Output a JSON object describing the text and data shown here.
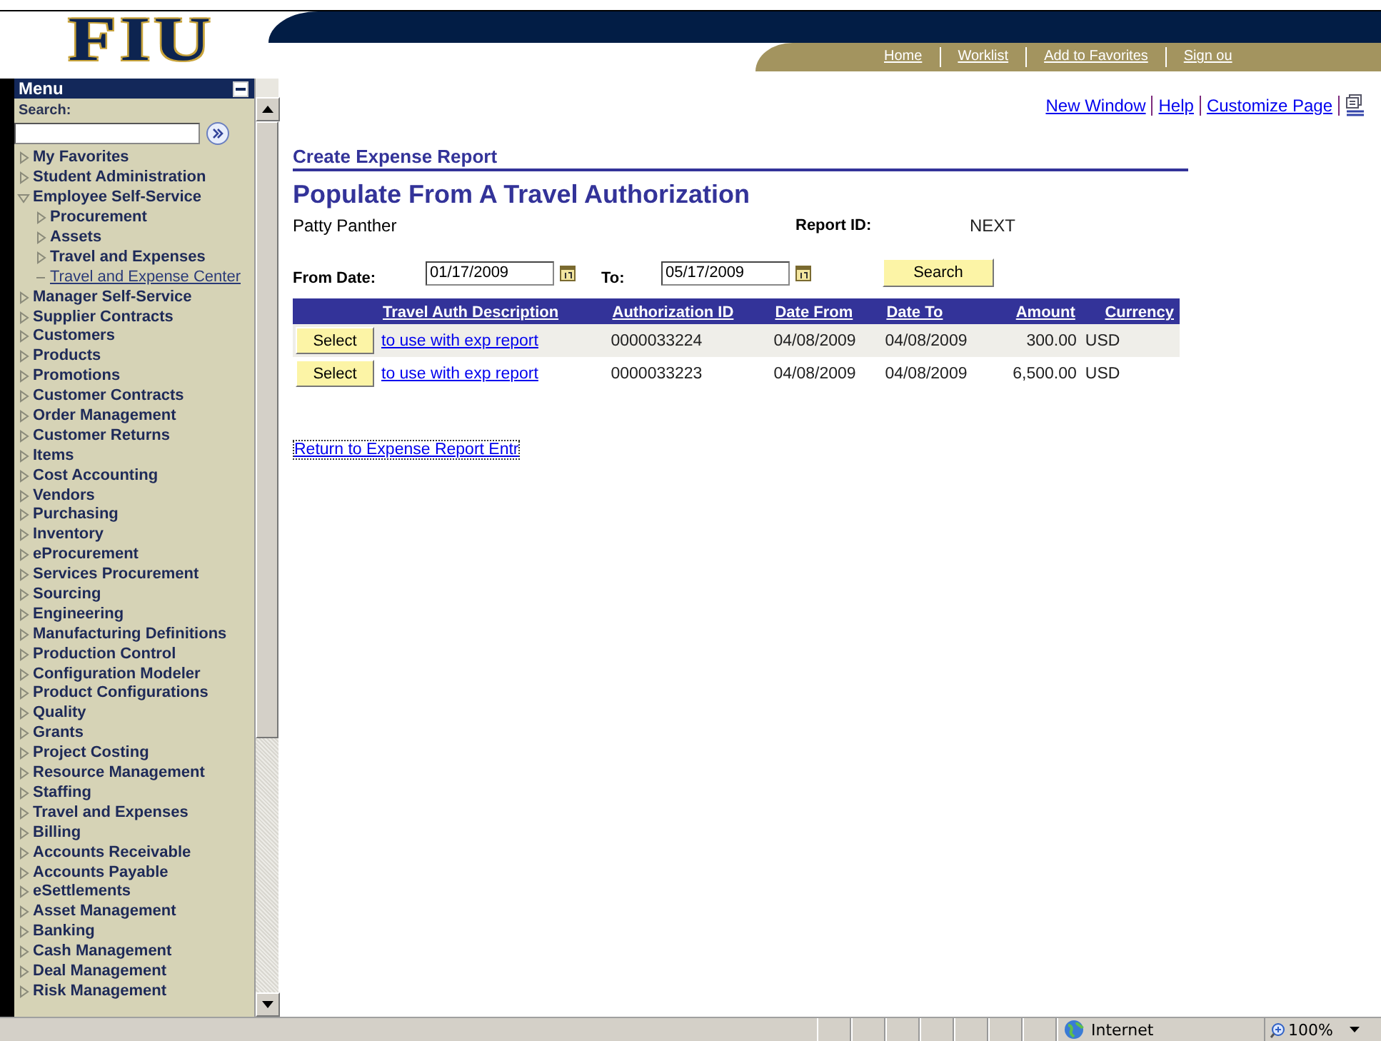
{
  "logo": "FIU",
  "header": {
    "nav_links": [
      "Home",
      "Worklist",
      "Add to Favorites",
      "Sign ou"
    ]
  },
  "menu": {
    "title": "Menu",
    "search_label": "Search:",
    "items": [
      {
        "kind": "folder",
        "label": "My Favorites",
        "expanded": false
      },
      {
        "kind": "folder",
        "label": "Student Administration",
        "expanded": false
      },
      {
        "kind": "folder",
        "label": "Employee Self-Service",
        "expanded": true,
        "children": [
          {
            "kind": "folder",
            "label": "Procurement",
            "expanded": false
          },
          {
            "kind": "folder",
            "label": "Assets",
            "expanded": false
          },
          {
            "kind": "folder",
            "label": "Travel and Expenses",
            "expanded": false
          },
          {
            "kind": "link",
            "label": "Travel and Expense Center"
          }
        ]
      },
      {
        "kind": "folder",
        "label": "Manager Self-Service",
        "expanded": false
      },
      {
        "kind": "folder",
        "label": "Supplier Contracts",
        "expanded": false
      },
      {
        "kind": "folder",
        "label": "Customers",
        "expanded": false
      },
      {
        "kind": "folder",
        "label": "Products",
        "expanded": false
      },
      {
        "kind": "folder",
        "label": "Promotions",
        "expanded": false
      },
      {
        "kind": "folder",
        "label": "Customer Contracts",
        "expanded": false
      },
      {
        "kind": "folder",
        "label": "Order Management",
        "expanded": false
      },
      {
        "kind": "folder",
        "label": "Customer Returns",
        "expanded": false
      },
      {
        "kind": "folder",
        "label": "Items",
        "expanded": false
      },
      {
        "kind": "folder",
        "label": "Cost Accounting",
        "expanded": false
      },
      {
        "kind": "folder",
        "label": "Vendors",
        "expanded": false
      },
      {
        "kind": "folder",
        "label": "Purchasing",
        "expanded": false
      },
      {
        "kind": "folder",
        "label": "Inventory",
        "expanded": false
      },
      {
        "kind": "folder",
        "label": "eProcurement",
        "expanded": false
      },
      {
        "kind": "folder",
        "label": "Services Procurement",
        "expanded": false
      },
      {
        "kind": "folder",
        "label": "Sourcing",
        "expanded": false
      },
      {
        "kind": "folder",
        "label": "Engineering",
        "expanded": false
      },
      {
        "kind": "folder",
        "label": "Manufacturing Definitions",
        "expanded": false
      },
      {
        "kind": "folder",
        "label": "Production Control",
        "expanded": false
      },
      {
        "kind": "folder",
        "label": "Configuration Modeler",
        "expanded": false
      },
      {
        "kind": "folder",
        "label": "Product Configurations",
        "expanded": false
      },
      {
        "kind": "folder",
        "label": "Quality",
        "expanded": false
      },
      {
        "kind": "folder",
        "label": "Grants",
        "expanded": false
      },
      {
        "kind": "folder",
        "label": "Project Costing",
        "expanded": false
      },
      {
        "kind": "folder",
        "label": "Resource Management",
        "expanded": false
      },
      {
        "kind": "folder",
        "label": "Staffing",
        "expanded": false
      },
      {
        "kind": "folder",
        "label": "Travel and Expenses",
        "expanded": false
      },
      {
        "kind": "folder",
        "label": "Billing",
        "expanded": false
      },
      {
        "kind": "folder",
        "label": "Accounts Receivable",
        "expanded": false
      },
      {
        "kind": "folder",
        "label": "Accounts Payable",
        "expanded": false
      },
      {
        "kind": "folder",
        "label": "eSettlements",
        "expanded": false
      },
      {
        "kind": "folder",
        "label": "Asset Management",
        "expanded": false
      },
      {
        "kind": "folder",
        "label": "Banking",
        "expanded": false
      },
      {
        "kind": "folder",
        "label": "Cash Management",
        "expanded": false
      },
      {
        "kind": "folder",
        "label": "Deal Management",
        "expanded": false
      },
      {
        "kind": "folder",
        "label": "Risk Management",
        "expanded": false
      }
    ]
  },
  "page_links": [
    "New Window",
    "Help",
    "Customize Page"
  ],
  "breadcrumb": "Create Expense Report",
  "title": "Populate From A Travel Authorization",
  "employee": "Patty Panther",
  "report_id": {
    "label": "Report ID:",
    "value": "NEXT"
  },
  "search": {
    "from_label": "From Date:",
    "from_value": "01/17/2009",
    "to_label": "To:",
    "to_value": "05/17/2009",
    "button": "Search"
  },
  "table": {
    "columns": [
      "Travel Auth Description",
      "Authorization ID",
      "Date From",
      "Date To",
      "Amount",
      "Currency"
    ],
    "rows": [
      {
        "button": "Select",
        "cells": [
          "to use with exp report",
          "0000033224",
          "04/08/2009",
          "04/08/2009",
          "300.00",
          "USD"
        ]
      },
      {
        "button": "Select",
        "cells": [
          "to use with exp report",
          "0000033223",
          "04/08/2009",
          "04/08/2009",
          "6,500.00",
          "USD"
        ]
      }
    ]
  },
  "return_link": "Return to Expense Report Entr",
  "status_bar": {
    "zone": "Internet",
    "zoom": "100%"
  }
}
